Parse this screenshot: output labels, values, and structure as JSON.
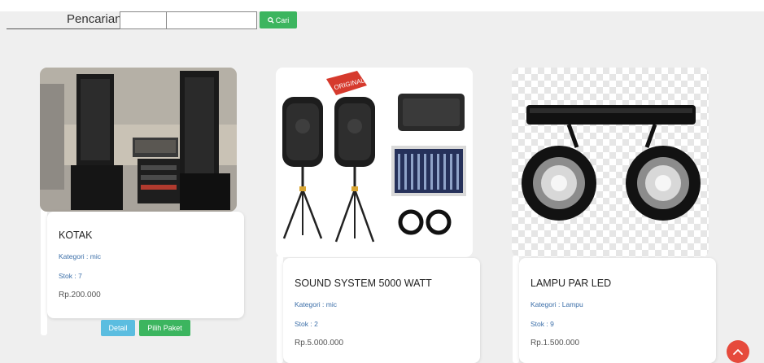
{
  "search": {
    "label": "Pencarian:",
    "button_label": "Cari",
    "button_icon": "search-icon"
  },
  "products": [
    {
      "title": "KOTAK",
      "kategori": "Kategori : mic",
      "stok": "Stok : 7",
      "harga": "Rp.200.000",
      "detail_label": "Detail",
      "pilih_label": "Pilih Paket"
    },
    {
      "title": "SOUND SYSTEM 5000 WATT",
      "kategori": "Kategori : mic",
      "stok": "Stok : 2",
      "harga": "Rp.5.000.000",
      "image_text": "ORIGINAL"
    },
    {
      "title": "LAMPU PAR LED",
      "kategori": "Kategori : Lampu",
      "stok": "Stok : 9",
      "harga": "Rp.1.500.000"
    }
  ],
  "colors": {
    "green_button": "#3cb55f",
    "blue_button": "#5bbde0",
    "link_blue": "#3b6ea8",
    "scroll_top_red": "#e64a3c",
    "page_background": "#efefef"
  },
  "scroll_top_icon": "chevron-up-icon"
}
